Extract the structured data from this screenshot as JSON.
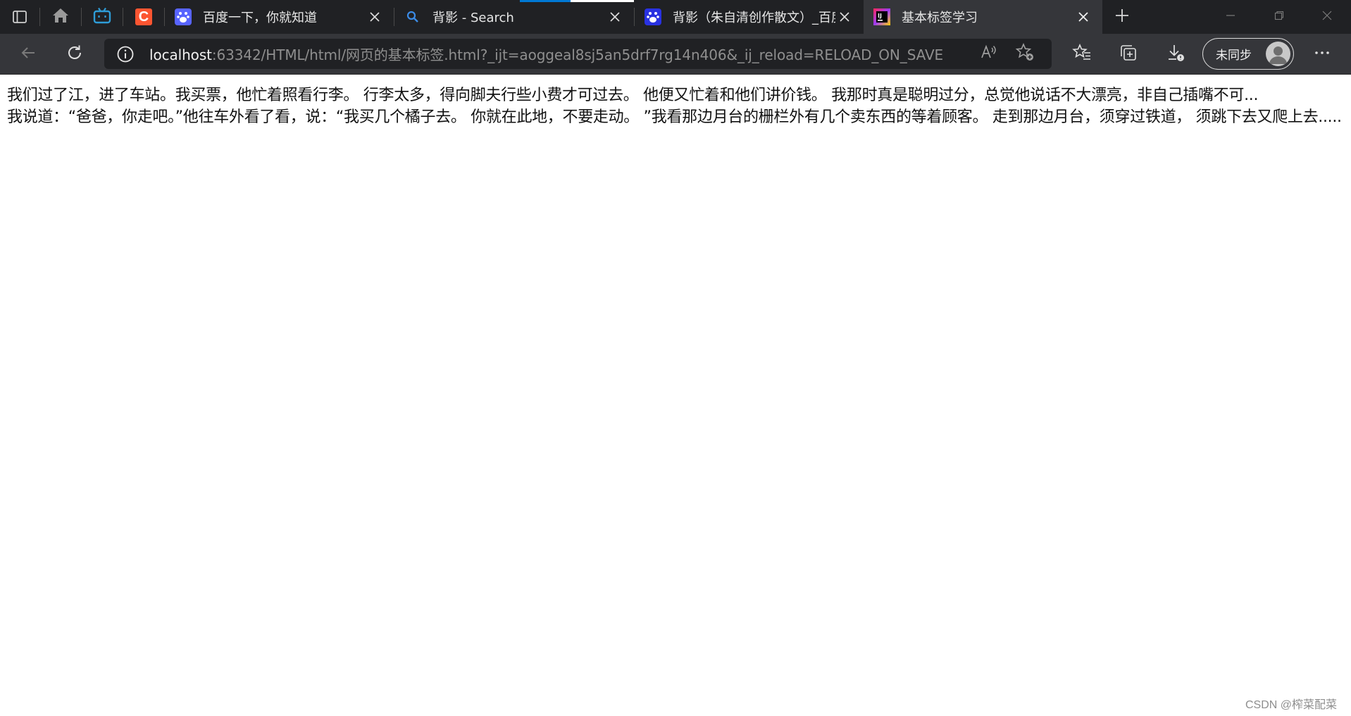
{
  "browser": {
    "tabs": [
      {
        "title": "百度一下，你就知道",
        "favicon": "baidu-paw-icon",
        "active": false
      },
      {
        "title": "背影 - Search",
        "favicon": "search-icon",
        "active": false
      },
      {
        "title": "背影（朱自清创作散文）_百度",
        "favicon": "baidu-paw-icon",
        "active": false
      },
      {
        "title": "基本标签学习",
        "favicon": "jetbrains-icon",
        "active": true
      }
    ],
    "pinned": [
      {
        "name": "home-icon"
      },
      {
        "name": "bilibili-icon"
      },
      {
        "name": "csdn-c-icon",
        "letter": "C"
      }
    ],
    "address": {
      "host": "localhost",
      "rest": ":63342/HTML/html/网页的基本标签.html?_ijt=aoggeal8sj5an5drf7rg14n406&_ij_reload=RELOAD_ON_SAVE"
    },
    "profile": {
      "label": "未同步"
    },
    "colors": {
      "accent": "#0078d4",
      "csdn": "#fc5531",
      "baidu": "#2932e1"
    }
  },
  "page": {
    "paragraph1": "我们过了江，进了车站。我买票，他忙着照看行李。 行李太多，得向脚夫行些小费才可过去。 他便又忙着和他们讲价钱。 我那时真是聪明过分，总觉他说话不大漂亮，非自己插嘴不可...",
    "paragraph2": "我说道：“爸爸，你走吧。”他往车外看了看，说：“我买几个橘子去。 你就在此地，不要走动。 ”我看那边月台的栅栏外有几个卖东西的等着顾客。 走到那边月台，须穿过铁道， 须跳下去又爬上去....."
  },
  "watermark": "CSDN @榨菜配菜"
}
